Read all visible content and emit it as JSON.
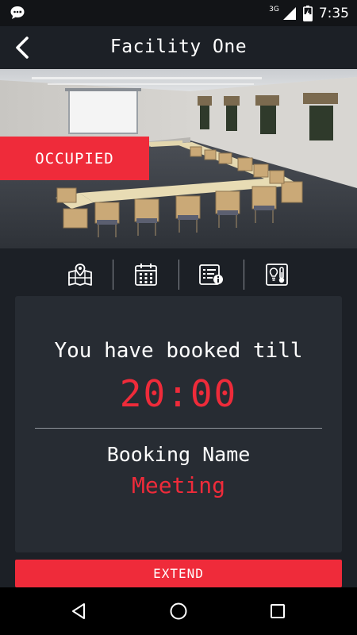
{
  "statusbar": {
    "time": "7:35",
    "network": "3G",
    "icons": [
      "chat-notification-icon",
      "signal-icon",
      "battery-charging-icon"
    ]
  },
  "appbar": {
    "title": "Facility One",
    "back_icon": "back-chevron-icon"
  },
  "hero": {
    "status": "OCCUPIED",
    "status_color": "#ef2b3a"
  },
  "tabs": [
    {
      "icon": "map-location-icon"
    },
    {
      "icon": "calendar-icon"
    },
    {
      "icon": "info-list-icon"
    },
    {
      "icon": "thermometer-light-icon"
    }
  ],
  "booking": {
    "lead": "You have booked till",
    "time": "20:00",
    "name_label": "Booking Name",
    "name_value": "Meeting"
  },
  "actions": {
    "extend_label": "EXTEND"
  },
  "colors": {
    "accent": "#ef2b3a",
    "background": "#1c2026",
    "card": "#272c33"
  }
}
